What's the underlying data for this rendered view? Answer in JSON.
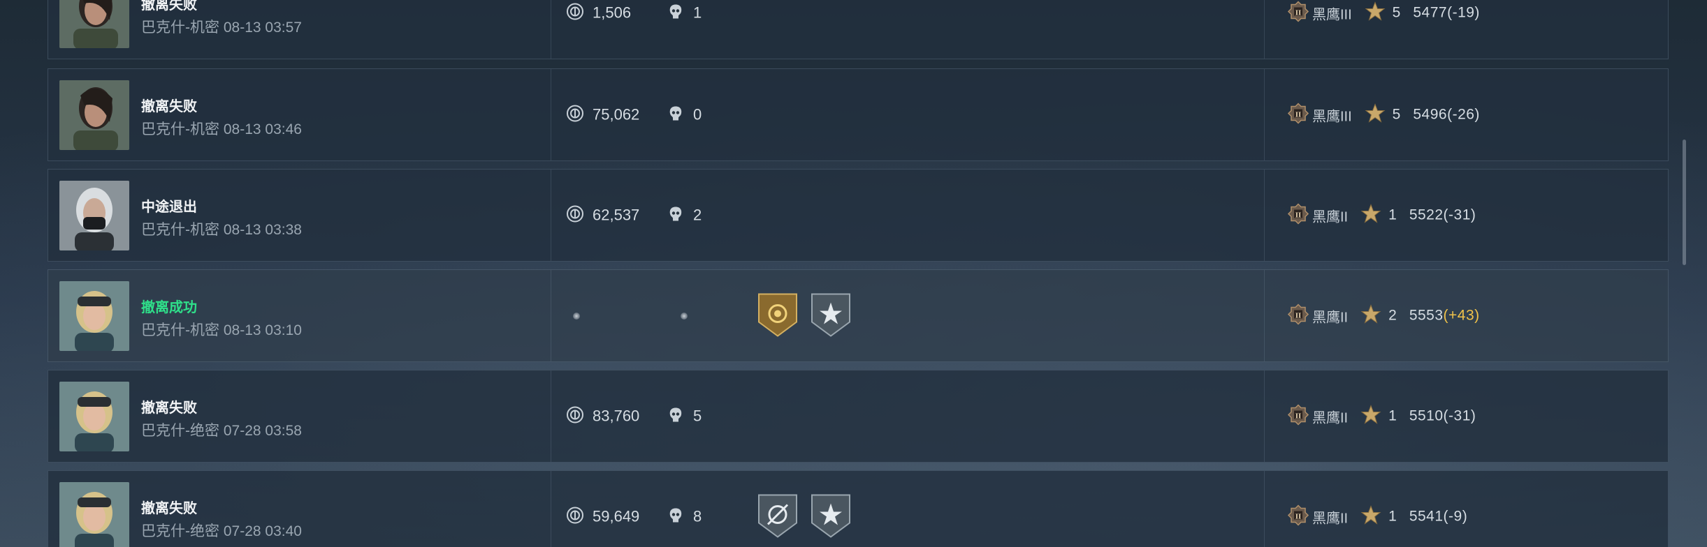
{
  "rows": [
    {
      "status": "撤离失败",
      "status_type": "fail",
      "map": "巴克什-机密",
      "time": "08-13 03:57",
      "value": "1,506",
      "kills": "1",
      "rank_name": "黑鹰III",
      "stars": "5",
      "score": "5477",
      "delta": "(-19)",
      "delta_type": "neg",
      "operator": "dark-hair-female",
      "badges": []
    },
    {
      "status": "撤离失败",
      "status_type": "fail",
      "map": "巴克什-机密",
      "time": "08-13 03:46",
      "value": "75,062",
      "kills": "0",
      "rank_name": "黑鹰III",
      "stars": "5",
      "score": "5496",
      "delta": "(-26)",
      "delta_type": "neg",
      "operator": "dark-hair-female",
      "badges": []
    },
    {
      "status": "中途退出",
      "status_type": "quit",
      "map": "巴克什-机密",
      "time": "08-13 03:38",
      "value": "62,537",
      "kills": "2",
      "rank_name": "黑鹰II",
      "stars": "1",
      "score": "5522",
      "delta": "(-31)",
      "delta_type": "neg",
      "operator": "masked-silver-hair",
      "badges": []
    },
    {
      "status": "撤离成功",
      "status_type": "success",
      "map": "巴克什-机密",
      "time": "08-13 03:10",
      "value": "",
      "kills": "",
      "rank_name": "黑鹰II",
      "stars": "2",
      "score": "5553",
      "delta": "(+43)",
      "delta_type": "pos",
      "operator": "blonde-goggles",
      "badges": [
        "gold-coin-badge",
        "gray-star-badge"
      ]
    },
    {
      "status": "撤离失败",
      "status_type": "fail",
      "map": "巴克什-绝密",
      "time": "07-28 03:58",
      "value": "83,760",
      "kills": "5",
      "rank_name": "黑鹰II",
      "stars": "1",
      "score": "5510",
      "delta": "(-31)",
      "delta_type": "neg",
      "operator": "blonde-goggles",
      "badges": []
    },
    {
      "status": "撤离失败",
      "status_type": "fail",
      "map": "巴克什-绝密",
      "time": "07-28 03:40",
      "value": "59,649",
      "kills": "8",
      "rank_name": "黑鹰II",
      "stars": "1",
      "score": "5541",
      "delta": "(-9)",
      "delta_type": "neg",
      "operator": "blonde-goggles",
      "badges": [
        "gray-crosshair-badge",
        "gray-star-badge"
      ]
    }
  ],
  "colors": {
    "success": "#2fe08a",
    "delta_positive": "#f0c24a",
    "text": "#d6dde3"
  }
}
